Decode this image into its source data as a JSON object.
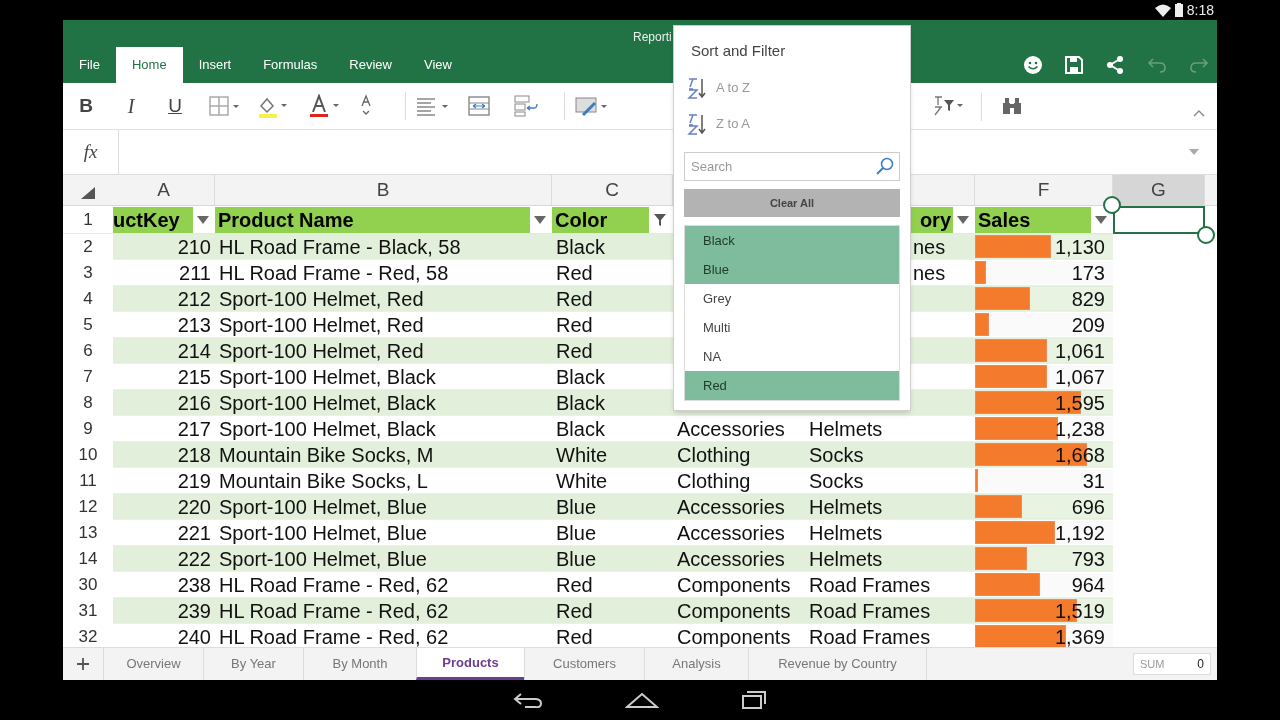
{
  "status_bar": {
    "time": "8:18"
  },
  "app": {
    "title": "Reporti",
    "tabs": [
      {
        "label": "File",
        "selected": false
      },
      {
        "label": "Home",
        "selected": true
      },
      {
        "label": "Insert",
        "selected": false
      },
      {
        "label": "Formulas",
        "selected": false
      },
      {
        "label": "Review",
        "selected": false
      },
      {
        "label": "View",
        "selected": false
      }
    ]
  },
  "ribbon": {
    "bold": "B",
    "italic": "I",
    "underline": "U"
  },
  "formula_bar": {
    "label": "fx"
  },
  "columns": [
    {
      "letter": "A"
    },
    {
      "letter": "B"
    },
    {
      "letter": "C"
    },
    {},
    {},
    {
      "letter": "F"
    },
    {
      "letter": "G",
      "selected": true
    }
  ],
  "header_row": {
    "number": "1",
    "cells": [
      {
        "text": "uctKey",
        "filtered": false
      },
      {
        "text": "Product Name",
        "filtered": false
      },
      {
        "text": "Color",
        "filtered": true
      },
      {},
      {
        "text": "ory",
        "filtered": false
      },
      {
        "text": "Sales",
        "filtered": false
      }
    ]
  },
  "rows": [
    {
      "number": "2",
      "key": "210",
      "name": "HL Road Frame - Black, 58",
      "color_name": "Black",
      "subcategory": "nes",
      "sales": "1,130",
      "level": 0.55
    },
    {
      "number": "3",
      "key": "211",
      "name": "HL Road Frame - Red, 58",
      "color_name": "Red",
      "subcategory": "nes",
      "sales": "173",
      "level": 0.08
    },
    {
      "number": "4",
      "key": "212",
      "name": "Sport-100 Helmet, Red",
      "color_name": "Red",
      "sales": "829",
      "level": 0.4
    },
    {
      "number": "5",
      "key": "213",
      "name": "Sport-100 Helmet, Red",
      "color_name": "Red",
      "sales": "209",
      "level": 0.1
    },
    {
      "number": "6",
      "key": "214",
      "name": "Sport-100 Helmet, Red",
      "color_name": "Red",
      "sales": "1,061",
      "level": 0.52
    },
    {
      "number": "7",
      "key": "215",
      "name": "Sport-100 Helmet, Black",
      "color_name": "Black",
      "sales": "1,067",
      "level": 0.52
    },
    {
      "number": "8",
      "key": "216",
      "name": "Sport-100 Helmet, Black",
      "color_name": "Black",
      "sales": "1,595",
      "level": 0.77
    },
    {
      "number": "9",
      "key": "217",
      "name": "Sport-100 Helmet, Black",
      "color_name": "Black",
      "category": "Accessories",
      "subcategory": "Helmets",
      "sales": "1,238",
      "level": 0.6
    },
    {
      "number": "10",
      "key": "218",
      "name": "Mountain Bike Socks, M",
      "color_name": "White",
      "category": "Clothing",
      "subcategory": "Socks",
      "sales": "1,668",
      "level": 0.81
    },
    {
      "number": "11",
      "key": "219",
      "name": "Mountain Bike Socks, L",
      "color_name": "White",
      "category": "Clothing",
      "subcategory": "Socks",
      "sales": "31",
      "level": 0.02
    },
    {
      "number": "12",
      "key": "220",
      "name": "Sport-100 Helmet, Blue",
      "color_name": "Blue",
      "category": "Accessories",
      "subcategory": "Helmets",
      "sales": "696",
      "level": 0.34
    },
    {
      "number": "13",
      "key": "221",
      "name": "Sport-100 Helmet, Blue",
      "color_name": "Blue",
      "category": "Accessories",
      "subcategory": "Helmets",
      "sales": "1,192",
      "level": 0.58
    },
    {
      "number": "14",
      "key": "222",
      "name": "Sport-100 Helmet, Blue",
      "color_name": "Blue",
      "category": "Accessories",
      "subcategory": "Helmets",
      "sales": "793",
      "level": 0.38
    },
    {
      "number": "30",
      "key": "238",
      "name": "HL Road Frame - Red, 62",
      "color_name": "Red",
      "category": "Components",
      "subcategory": "Road Frames",
      "sales": "964",
      "level": 0.47
    },
    {
      "number": "31",
      "key": "239",
      "name": "HL Road Frame - Red, 62",
      "color_name": "Red",
      "category": "Components",
      "subcategory": "Road Frames",
      "sales": "1,519",
      "level": 0.74
    },
    {
      "number": "32",
      "key": "240",
      "name": "HL Road Frame - Red, 62",
      "color_name": "Red",
      "category": "Components",
      "subcategory": "Road Frames",
      "sales": "1,369",
      "level": 0.66
    }
  ],
  "popup": {
    "title": "Sort and Filter",
    "sort": [
      {
        "label": "A to Z"
      },
      {
        "label": "Z to A"
      }
    ],
    "search": {
      "placeholder": "Search"
    },
    "clear": "Clear All",
    "items": [
      {
        "label": "Black",
        "selected": true
      },
      {
        "label": "Blue",
        "selected": true
      },
      {
        "label": "Grey",
        "selected": false
      },
      {
        "label": "Multi",
        "selected": false
      },
      {
        "label": "NA",
        "selected": false
      },
      {
        "label": "Red",
        "selected": true
      }
    ]
  },
  "sheet_tabs": [
    {
      "label": "Overview",
      "selected": false
    },
    {
      "label": "By Year",
      "selected": false
    },
    {
      "label": "By Month",
      "selected": false
    },
    {
      "label": "Products",
      "selected": true
    },
    {
      "label": "Customers",
      "selected": false
    },
    {
      "label": "Analysis",
      "selected": false
    },
    {
      "label": "Revenue by Country",
      "selected": false
    }
  ],
  "sum": {
    "label": "SUM",
    "value": "0"
  }
}
